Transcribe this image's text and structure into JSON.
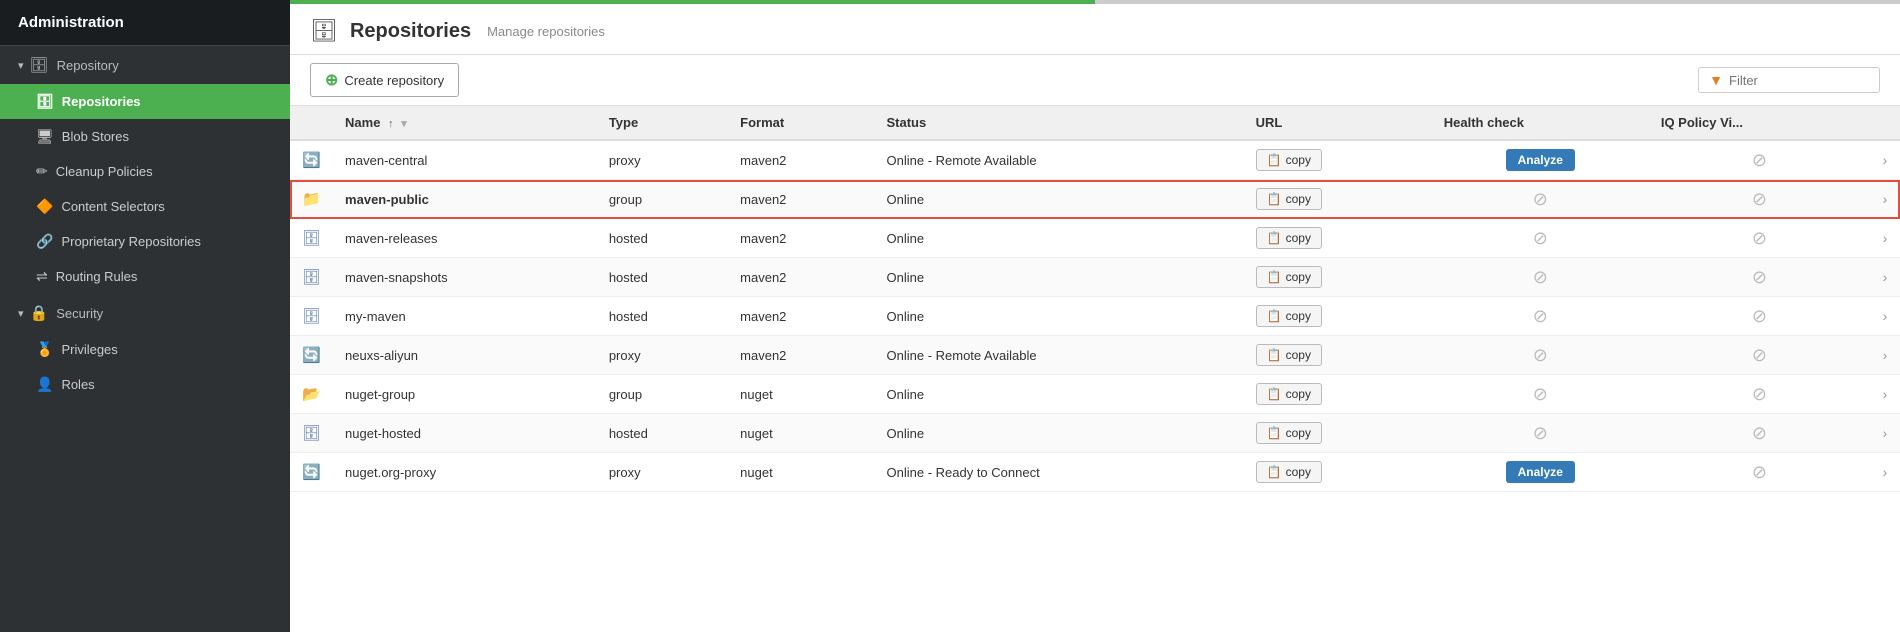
{
  "sidebar": {
    "title": "Administration",
    "sections": [
      {
        "id": "repository",
        "label": "Repository",
        "icon": "▾",
        "expanded": true,
        "items": [
          {
            "id": "repositories",
            "label": "Repositories",
            "icon": "🗄",
            "active": true
          },
          {
            "id": "blob-stores",
            "label": "Blob Stores",
            "icon": "🖥"
          },
          {
            "id": "cleanup-policies",
            "label": "Cleanup Policies",
            "icon": "✏"
          },
          {
            "id": "content-selectors",
            "label": "Content Selectors",
            "icon": "🔶"
          },
          {
            "id": "proprietary-repositories",
            "label": "Proprietary Repositories",
            "icon": "🔗"
          },
          {
            "id": "routing-rules",
            "label": "Routing Rules",
            "icon": "⇌"
          }
        ]
      },
      {
        "id": "security",
        "label": "Security",
        "icon": "▾",
        "expanded": true,
        "items": [
          {
            "id": "privileges",
            "label": "Privileges",
            "icon": "🏅"
          },
          {
            "id": "roles",
            "label": "Roles",
            "icon": "👤"
          }
        ]
      }
    ]
  },
  "page": {
    "icon": "🗄",
    "title": "Repositories",
    "subtitle": "Manage repositories",
    "create_button": "Create repository",
    "filter_placeholder": "Filter"
  },
  "table": {
    "columns": [
      {
        "id": "icon",
        "label": ""
      },
      {
        "id": "name",
        "label": "Name",
        "sortable": true,
        "sort_dir": "asc",
        "filterable": true
      },
      {
        "id": "type",
        "label": "Type"
      },
      {
        "id": "format",
        "label": "Format"
      },
      {
        "id": "status",
        "label": "Status"
      },
      {
        "id": "url",
        "label": "URL"
      },
      {
        "id": "health_check",
        "label": "Health check"
      },
      {
        "id": "iq_policy",
        "label": "IQ Policy Vi..."
      },
      {
        "id": "actions",
        "label": ""
      }
    ],
    "rows": [
      {
        "id": "maven-central",
        "icon": "proxy",
        "name": "maven-central",
        "type": "proxy",
        "format": "maven2",
        "status": "Online - Remote Available",
        "copy_label": "copy",
        "health_check": "analyze",
        "iq_policy": "disabled",
        "selected": false
      },
      {
        "id": "maven-public",
        "icon": "group",
        "name": "maven-public",
        "type": "group",
        "format": "maven2",
        "status": "Online",
        "copy_label": "copy",
        "health_check": "disabled",
        "iq_policy": "disabled",
        "selected": true
      },
      {
        "id": "maven-releases",
        "icon": "hosted",
        "name": "maven-releases",
        "type": "hosted",
        "format": "maven2",
        "status": "Online",
        "copy_label": "copy",
        "health_check": "disabled",
        "iq_policy": "disabled",
        "selected": false
      },
      {
        "id": "maven-snapshots",
        "icon": "hosted",
        "name": "maven-snapshots",
        "type": "hosted",
        "format": "maven2",
        "status": "Online",
        "copy_label": "copy",
        "health_check": "disabled",
        "iq_policy": "disabled",
        "selected": false
      },
      {
        "id": "my-maven",
        "icon": "hosted",
        "name": "my-maven",
        "type": "hosted",
        "format": "maven2",
        "status": "Online",
        "copy_label": "copy",
        "health_check": "disabled",
        "iq_policy": "disabled",
        "selected": false
      },
      {
        "id": "neuxs-aliyun",
        "icon": "proxy",
        "name": "neuxs-aliyun",
        "type": "proxy",
        "format": "maven2",
        "status": "Online - Remote Available",
        "copy_label": "copy",
        "health_check": "disabled",
        "iq_policy": "disabled",
        "selected": false
      },
      {
        "id": "nuget-group",
        "icon": "group",
        "name": "nuget-group",
        "type": "group",
        "format": "nuget",
        "status": "Online",
        "copy_label": "copy",
        "health_check": "disabled",
        "iq_policy": "disabled",
        "selected": false
      },
      {
        "id": "nuget-hosted",
        "icon": "hosted",
        "name": "nuget-hosted",
        "type": "hosted",
        "format": "nuget",
        "status": "Online",
        "copy_label": "copy",
        "health_check": "disabled",
        "iq_policy": "disabled",
        "selected": false
      },
      {
        "id": "nuget-org-proxy",
        "icon": "proxy",
        "name": "nuget.org-proxy",
        "type": "proxy",
        "format": "nuget",
        "status": "Online - Ready to Connect",
        "copy_label": "copy",
        "health_check": "analyze",
        "iq_policy": "disabled",
        "selected": false
      }
    ]
  },
  "icons": {
    "repo_proxy": "🔄",
    "repo_hosted": "🗄",
    "repo_group_maven": "📁",
    "repo_group_nuget": "📂",
    "copy_icon": "📋",
    "filter_icon": "▼",
    "disabled_circle": "⊘",
    "chevron_right": "›",
    "plus": "⊕",
    "sort_asc": "↑",
    "col_filter": "▾"
  },
  "colors": {
    "active_sidebar": "#4caf50",
    "analyze_btn": "#337ab7",
    "selected_row_border": "#e74c3c",
    "filter_icon": "#e67e22"
  }
}
